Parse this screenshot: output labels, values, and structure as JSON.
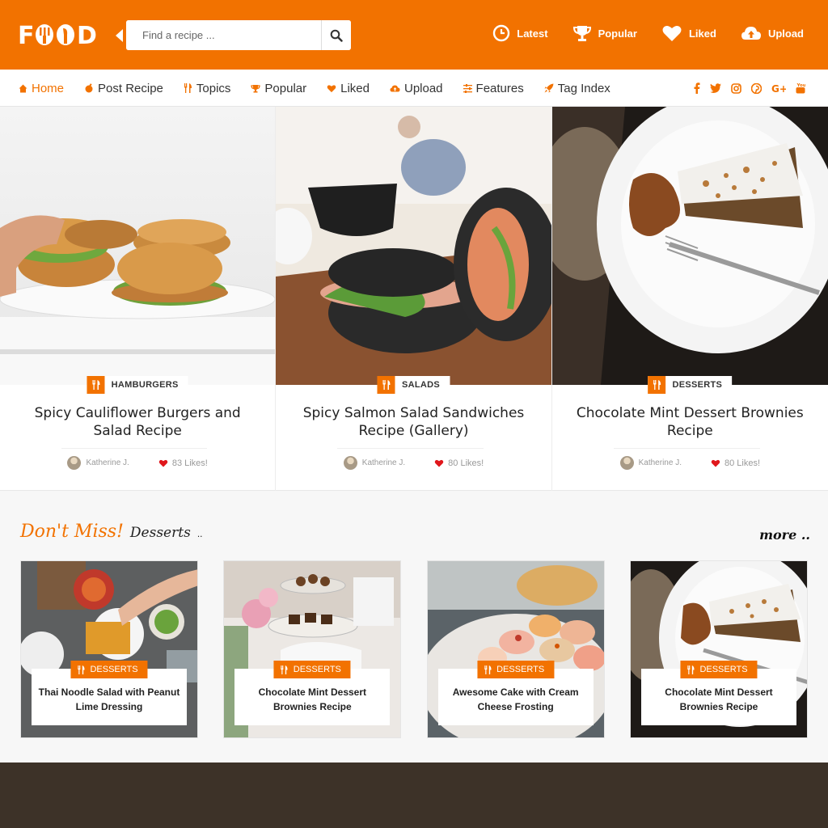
{
  "brand": {
    "logo": "FOOD",
    "accent": "#f27200"
  },
  "search": {
    "placeholder": "Find a recipe ..."
  },
  "top_links": [
    {
      "label": "Latest",
      "icon": "clock-icon"
    },
    {
      "label": "Popular",
      "icon": "trophy-icon"
    },
    {
      "label": "Liked",
      "icon": "heart-icon"
    },
    {
      "label": "Upload",
      "icon": "cloud-upload-icon"
    }
  ],
  "nav": [
    {
      "label": "Home",
      "icon": "home-icon",
      "active": true
    },
    {
      "label": "Post Recipe",
      "icon": "pot-icon"
    },
    {
      "label": "Topics",
      "icon": "cutlery-icon"
    },
    {
      "label": "Popular",
      "icon": "trophy-icon"
    },
    {
      "label": "Liked",
      "icon": "heart-icon"
    },
    {
      "label": "Upload",
      "icon": "cloud-upload-icon"
    },
    {
      "label": "Features",
      "icon": "sliders-icon"
    },
    {
      "label": "Tag Index",
      "icon": "rocket-icon"
    }
  ],
  "social": [
    "f",
    "t",
    "ig",
    "p",
    "G+",
    "yt"
  ],
  "featured": [
    {
      "category": "HAMBURGERS",
      "title": "Spicy Cauliflower Burgers and Salad Recipe",
      "author": "Katherine J.",
      "likes": "83 Likes!"
    },
    {
      "category": "SALADS",
      "title": "Spicy Salmon Salad Sandwiches Recipe (Gallery)",
      "author": "Katherine J.",
      "likes": "80 Likes!"
    },
    {
      "category": "DESSERTS",
      "title": "Chocolate Mint Dessert Brownies Recipe",
      "author": "Katherine J.",
      "likes": "80 Likes!"
    }
  ],
  "dont_miss": {
    "label": "Don't Miss!",
    "section": "Desserts",
    "dots": "..",
    "more": "more ..",
    "cards": [
      {
        "category": "DESSERTS",
        "title": "Thai Noodle Salad with Peanut Lime Dressing"
      },
      {
        "category": "DESSERTS",
        "title": "Chocolate Mint Dessert Brownies Recipe"
      },
      {
        "category": "DESSERTS",
        "title": "Awesome Cake with Cream Cheese Frosting"
      },
      {
        "category": "DESSERTS",
        "title": "Chocolate Mint Dessert Brownies Recipe"
      }
    ]
  }
}
